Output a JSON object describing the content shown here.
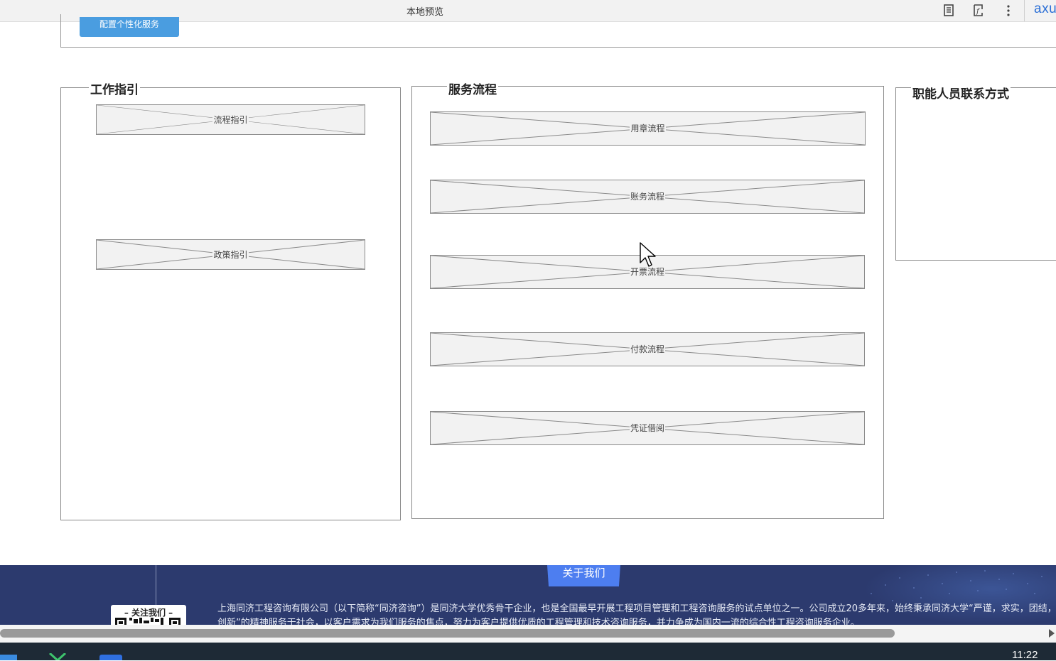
{
  "window": {
    "title": "本地预览",
    "brand": "axu"
  },
  "top": {
    "config_button": "配置个性化服务"
  },
  "panels": {
    "work_guide": {
      "title": "工作指引",
      "items": [
        "流程指引",
        "政策指引"
      ]
    },
    "service_flow": {
      "title": "服务流程",
      "items": [
        "用章流程",
        "账务流程",
        "开票流程",
        "付款流程",
        "凭证借阅"
      ]
    },
    "contacts": {
      "title": "职能人员联系方式"
    }
  },
  "footer": {
    "about_tab": "关于我们",
    "qr_title": "– 关注我们 –",
    "description_line1": "上海同济工程咨询有限公司（以下简称“同济咨询”）是同济大学优秀骨干企业，也是全国最早开展工程项目管理和工程咨询服务的试点单位之一。公司成立20多年来，始终秉承同济大学“严谨，求实，团结，",
    "description_line2": "创新”的精神服务于社会，以客户需求为我们服务的焦点，努力为客户提供优质的工程管理和技术咨询服务，并力争成为国内一流的综合性工程咨询服务企业。"
  },
  "taskbar": {
    "clock": "11:22"
  },
  "icons": [
    "document-icon",
    "formula-icon",
    "more-vertical-icon",
    "mouse-cursor-icon",
    "scroll-right-arrow-icon"
  ]
}
